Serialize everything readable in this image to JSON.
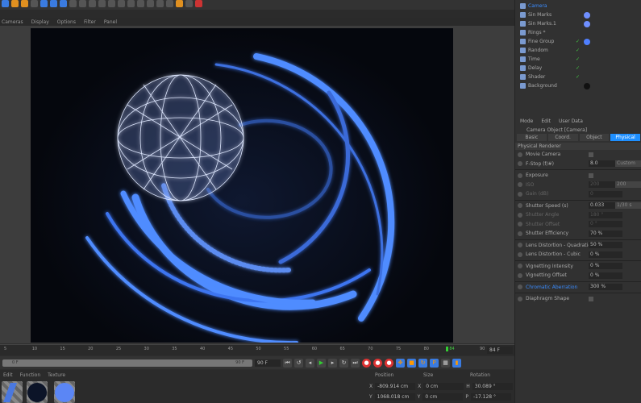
{
  "viewport_menu": [
    "Cameras",
    "Display",
    "Options",
    "Filter",
    "Panel"
  ],
  "objects": [
    {
      "name": "Camera",
      "active": true,
      "tag": null
    },
    {
      "name": "Sin Marks",
      "tag": "#6f8fff"
    },
    {
      "name": "Sin Marks.1",
      "tag": "#6f8fff"
    },
    {
      "name": "Rings *",
      "tag": null
    },
    {
      "name": "Fine Group",
      "tag": "#4f7fff",
      "check": true
    },
    {
      "name": "Random",
      "check": true
    },
    {
      "name": "Time",
      "check": true
    },
    {
      "name": "Delay",
      "check": true
    },
    {
      "name": "Shader",
      "check": true
    },
    {
      "name": "Background",
      "tag": "#111111"
    }
  ],
  "attr": {
    "menu": [
      "Mode",
      "Edit",
      "User Data"
    ],
    "title": "Camera Object [Camera]",
    "tabs": [
      "Basic",
      "Coord.",
      "Object",
      "Physical"
    ],
    "active_tab": "Physical",
    "section": "Physical Renderer"
  },
  "params": [
    {
      "label": "Movie Camera",
      "type": "check"
    },
    {
      "label": "F-Stop (f/#)",
      "value": "8.0",
      "button": "Custom"
    },
    {
      "sep": true
    },
    {
      "label": "Exposure",
      "type": "check"
    },
    {
      "label": "ISO",
      "value": "200",
      "disabled": true,
      "button": "200"
    },
    {
      "label": "Gain (dB)",
      "value": "0",
      "disabled": true
    },
    {
      "sep": true
    },
    {
      "label": "Shutter Speed (s)",
      "value": "0.033",
      "button": "1/30 s"
    },
    {
      "label": "Shutter Angle",
      "value": "180 °",
      "disabled": true
    },
    {
      "label": "Shutter Offset",
      "value": "0 °",
      "disabled": true
    },
    {
      "label": "Shutter Efficiency",
      "value": "70 %"
    },
    {
      "sep": true
    },
    {
      "label": "Lens Distortion - Quadratic",
      "value": "50 %"
    },
    {
      "label": "Lens Distortion - Cubic",
      "value": "0 %"
    },
    {
      "sep": true
    },
    {
      "label": "Vignetting Intensity",
      "value": "0 %"
    },
    {
      "label": "Vignetting Offset",
      "value": "0 %"
    },
    {
      "sep": true
    },
    {
      "label": "Chromatic Aberration",
      "value": "300 %",
      "highlight": true
    },
    {
      "sep": true
    },
    {
      "label": "Diaphragm Shape",
      "type": "check"
    }
  ],
  "timeline": {
    "ticks": [
      "5",
      "10",
      "15",
      "20",
      "25",
      "30",
      "35",
      "40",
      "45",
      "50",
      "55",
      "60",
      "65",
      "70",
      "75",
      "80",
      "84",
      "90"
    ],
    "current_frame": "84",
    "frame_field": "84 F",
    "start": "0 F",
    "end": "90 F",
    "fps_field": "90 F"
  },
  "materials": {
    "menu": [
      "Edit",
      "Function",
      "Texture"
    ],
    "swatches": [
      "#4a78e0",
      "#0c1428",
      "#5b86f5"
    ]
  },
  "coords": {
    "headers": [
      "Position",
      "Size",
      "Rotation"
    ],
    "rows": [
      {
        "axis": "X",
        "pos": "-809.914 cm",
        "saxis": "X",
        "size": "0 cm",
        "raxis": "H",
        "rot": "30.089 °"
      },
      {
        "axis": "Y",
        "pos": "1068.018 cm",
        "saxis": "Y",
        "size": "0 cm",
        "raxis": "P",
        "rot": "-17.128 °"
      }
    ]
  },
  "colors": {
    "accent": "#1e8fff",
    "glow": "#4f8cff"
  }
}
